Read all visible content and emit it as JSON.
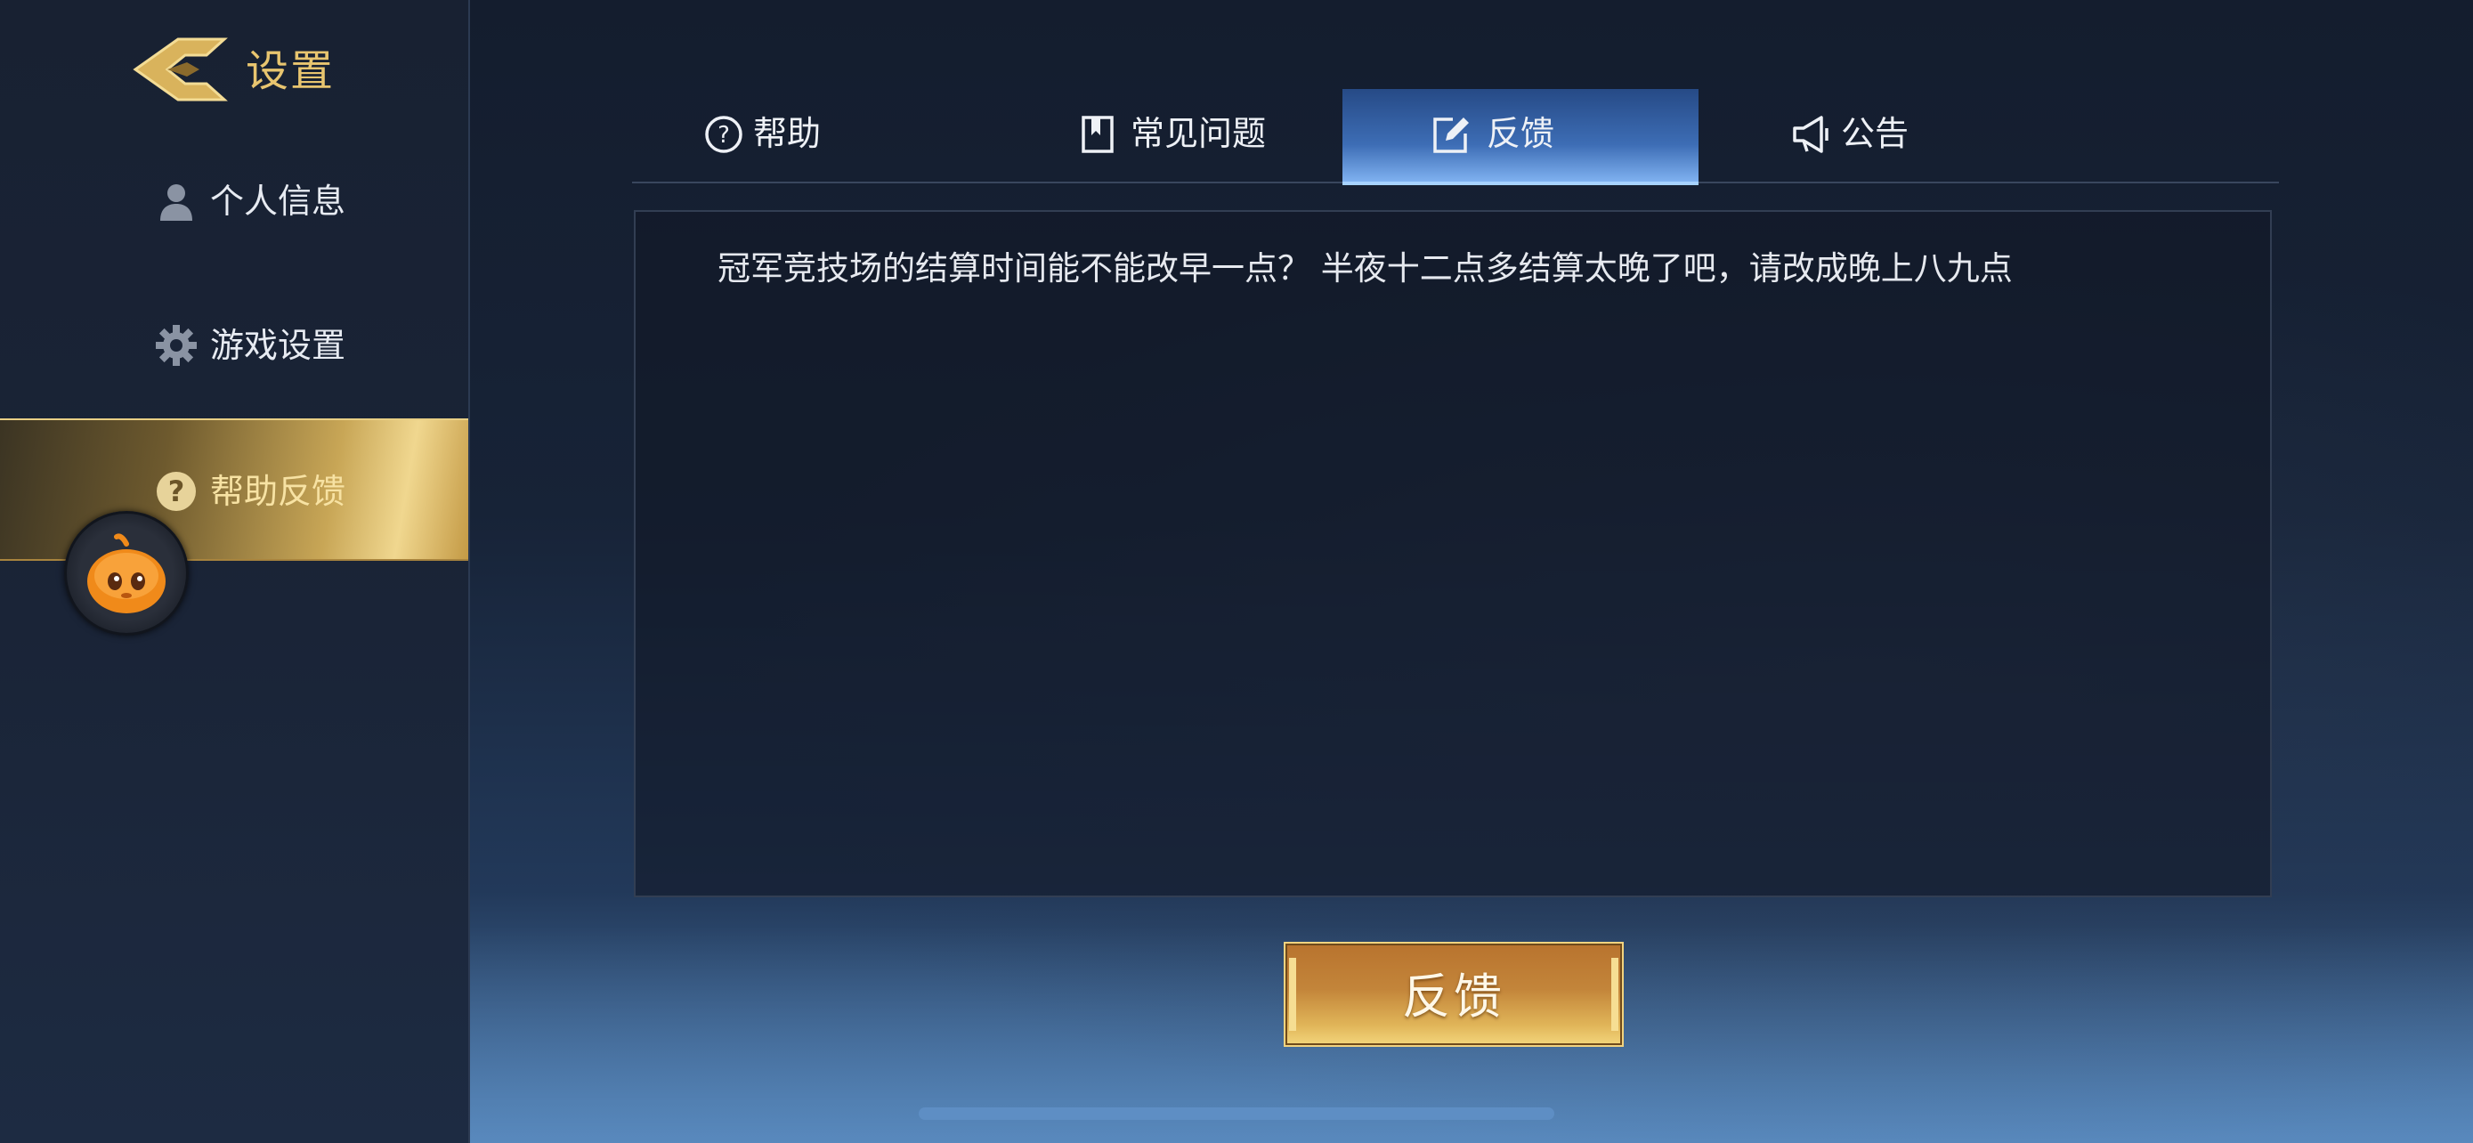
{
  "header": {
    "title": "设置",
    "back_icon": "back-arrow-icon"
  },
  "sidebar": {
    "items": [
      {
        "label": "个人信息",
        "icon": "person-icon",
        "active": false
      },
      {
        "label": "游戏设置",
        "icon": "gear-icon",
        "active": false
      },
      {
        "label": "帮助反馈",
        "icon": "question-icon",
        "active": true
      }
    ]
  },
  "tabs": [
    {
      "label": "帮助",
      "icon": "question-circle-icon",
      "active": false
    },
    {
      "label": "常见问题",
      "icon": "bookmark-icon",
      "active": false
    },
    {
      "label": "反馈",
      "icon": "edit-icon",
      "active": true
    },
    {
      "label": "公告",
      "icon": "megaphone-icon",
      "active": false
    }
  ],
  "feedback": {
    "text": "冠军竞技场的结算时间能不能改早一点？ 半夜十二点多结算太晚了吧，请改成晚上八九点"
  },
  "submit": {
    "label": "反馈"
  },
  "colors": {
    "gold": "#e8c56f",
    "active_tab": "#3d6db5",
    "button": "#c3853a"
  }
}
